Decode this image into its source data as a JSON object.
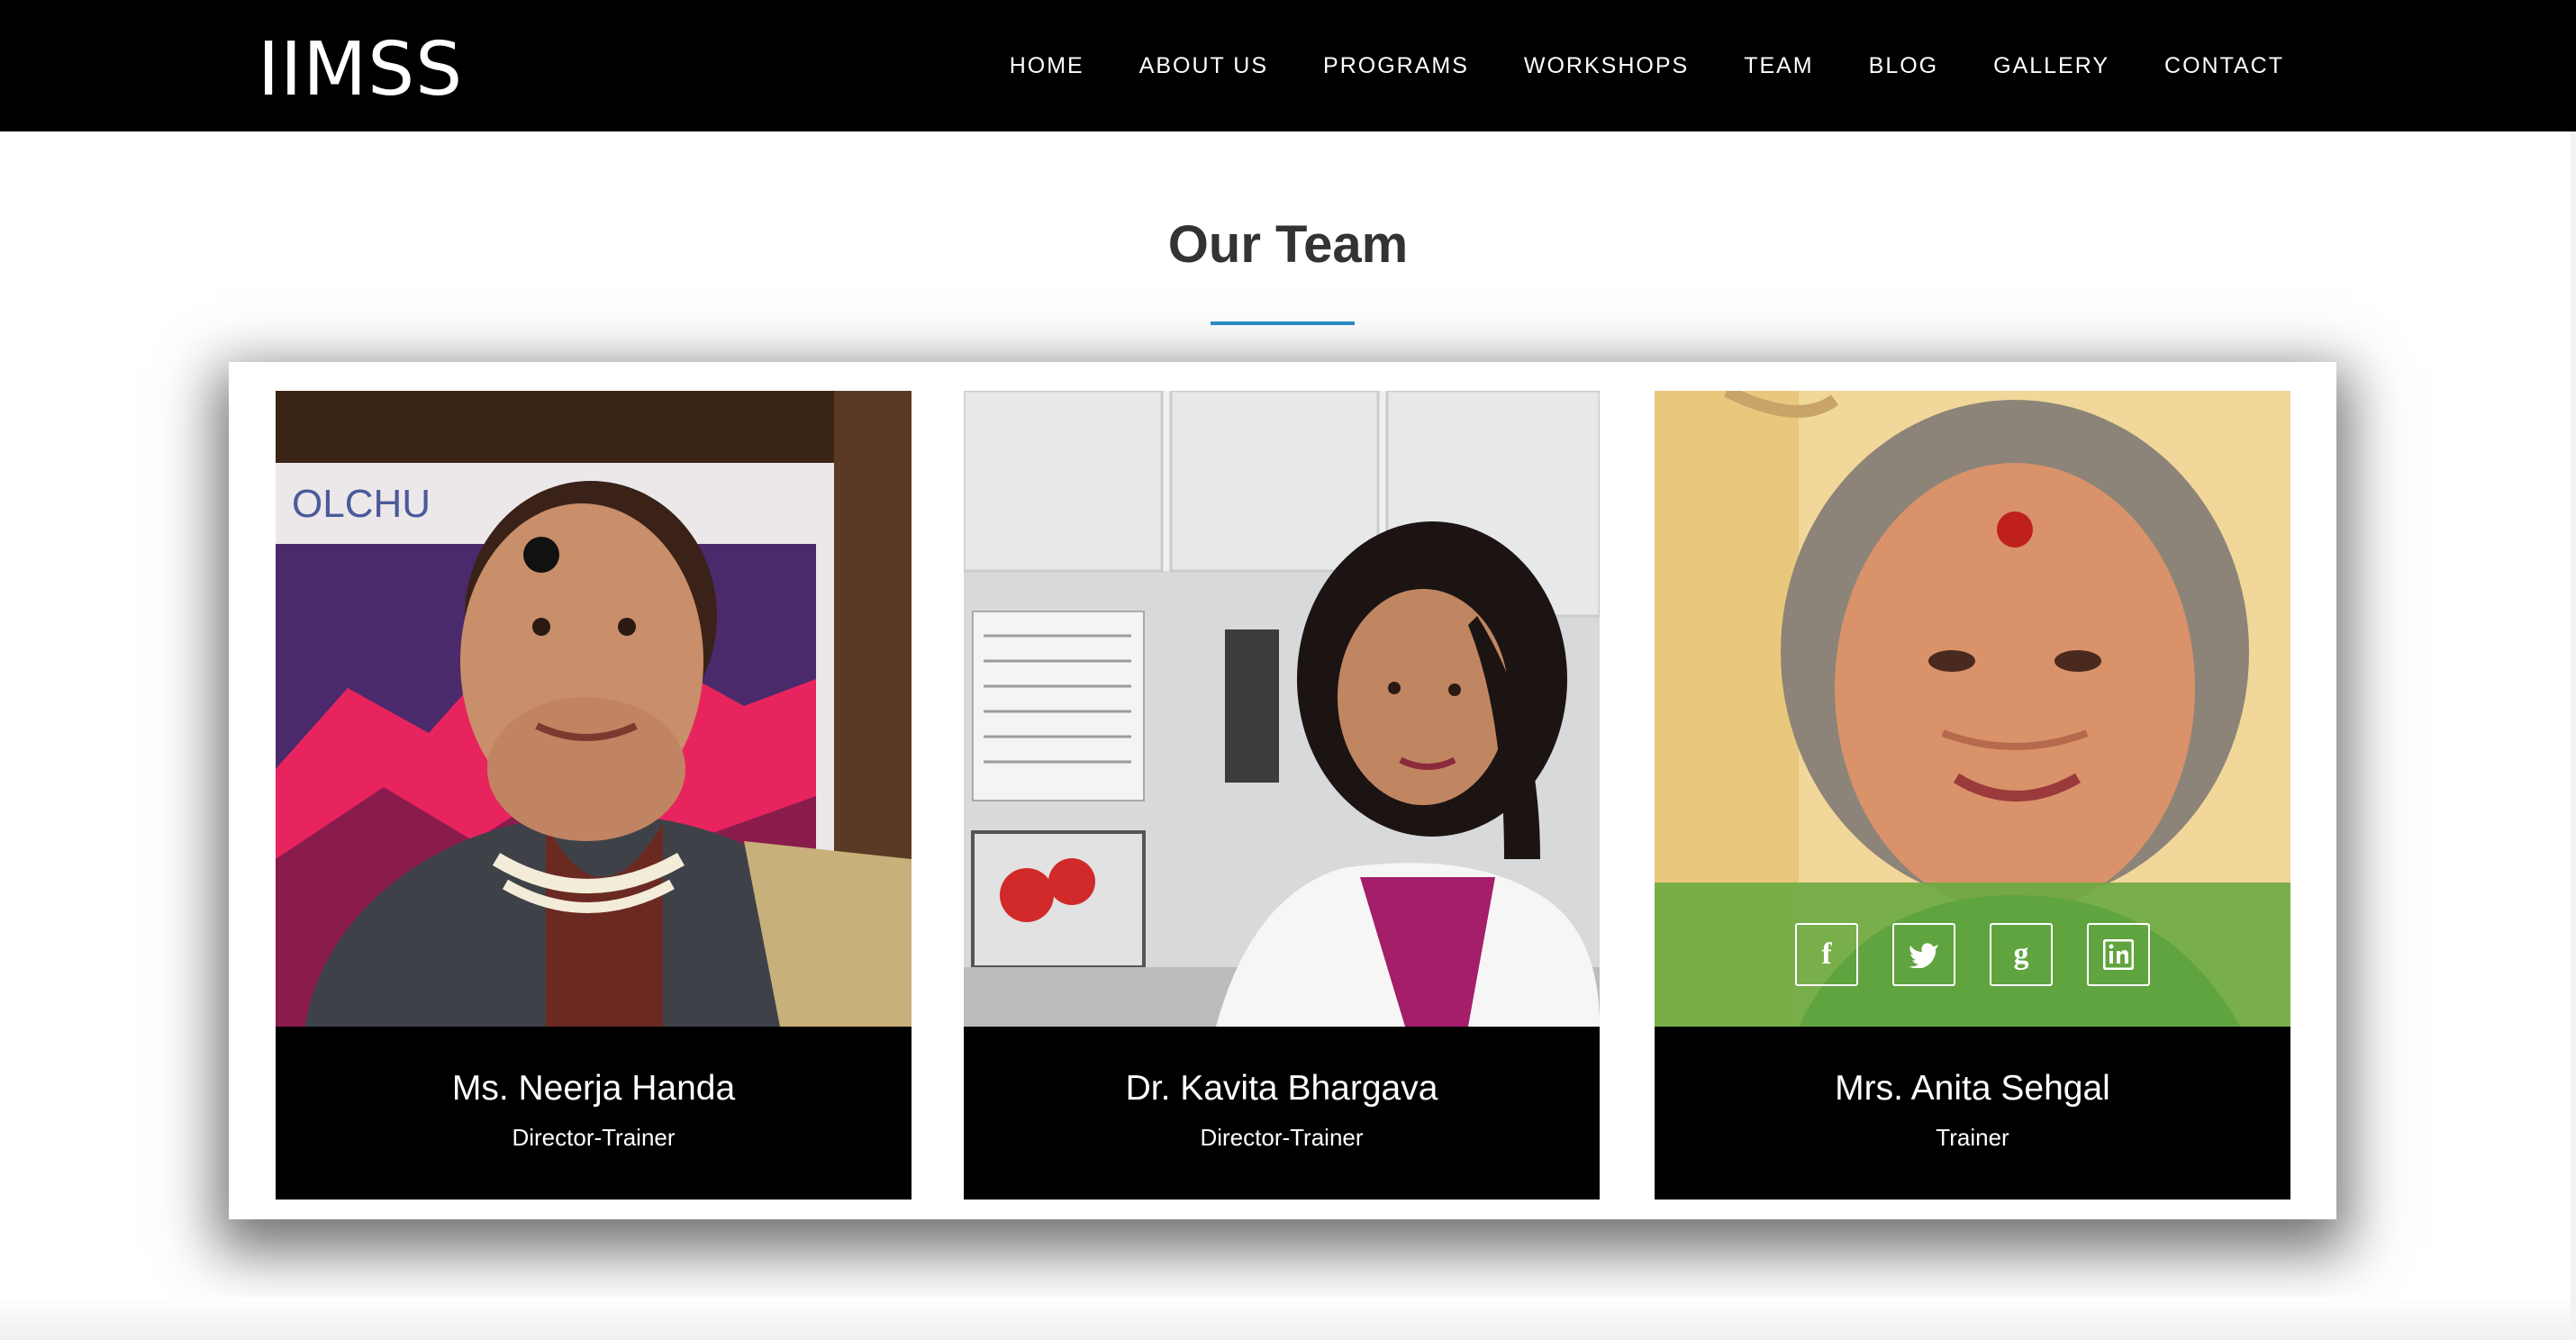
{
  "header": {
    "logo": "IIMSS",
    "nav": [
      "HOME",
      "ABOUT US",
      "PROGRAMS",
      "WORKSHOPS",
      "TEAM",
      "BLOG",
      "GALLERY",
      "CONTACT"
    ]
  },
  "team": {
    "title": "Our Team",
    "accent_color": "#2c8fcd",
    "members": [
      {
        "name": "Ms. Neerja Handa",
        "role": "Director-Trainer",
        "photo_label": "OLCHU"
      },
      {
        "name": "Dr. Kavita Bhargava",
        "role": "Director-Trainer"
      },
      {
        "name": "Mrs. Anita Sehgal",
        "role": "Trainer"
      }
    ],
    "social_icons": [
      "facebook-icon",
      "twitter-icon",
      "google-plus-icon",
      "linkedin-icon"
    ],
    "social_glyphs": [
      "f",
      "t",
      "g",
      "in"
    ],
    "overlay_color": "#68aa40"
  }
}
